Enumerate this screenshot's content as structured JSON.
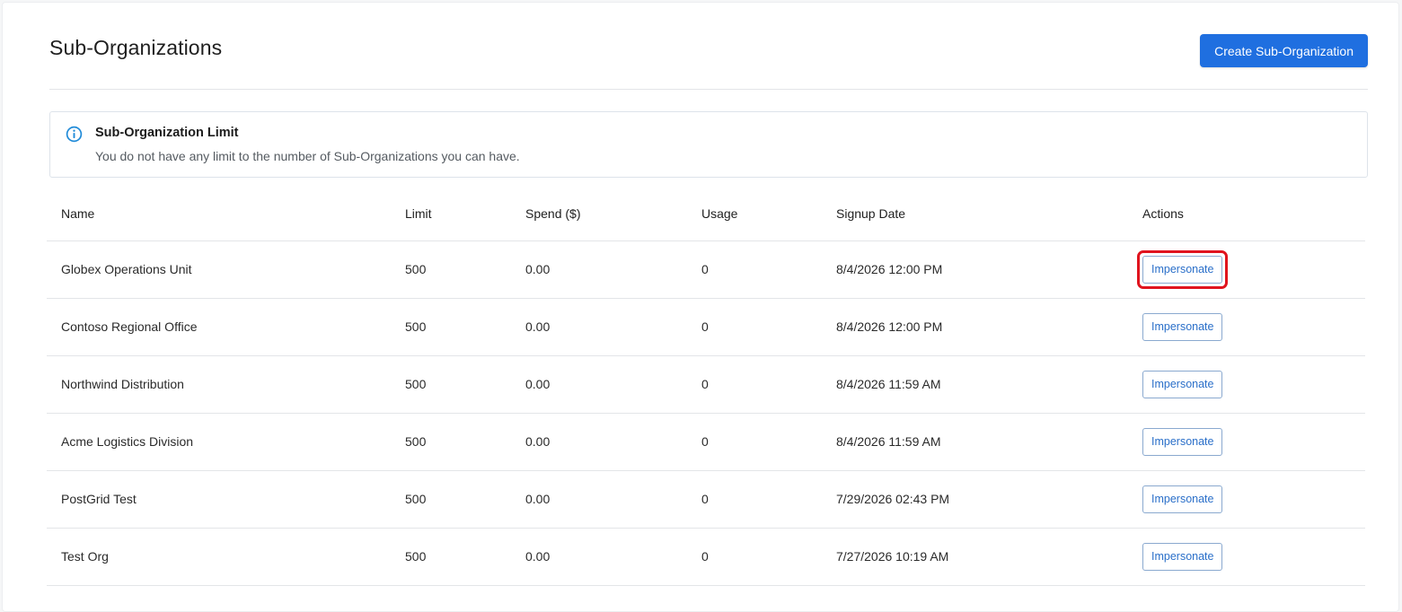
{
  "header": {
    "title": "Sub-Organizations",
    "create_button": "Create Sub-Organization"
  },
  "alert": {
    "icon": "info-icon",
    "title": "Sub-Organization Limit",
    "message": "You do not have any limit to the number of Sub-Organizations you can have."
  },
  "table": {
    "columns": [
      "Name",
      "Limit",
      "Spend ($)",
      "Usage",
      "Signup Date",
      "Actions"
    ],
    "rows": [
      {
        "name": "Globex Operations Unit",
        "limit": "500",
        "spend": "0.00",
        "usage": "0",
        "signup": "8/4/2026 12:00 PM",
        "action": "Impersonate"
      },
      {
        "name": "Contoso Regional Office",
        "limit": "500",
        "spend": "0.00",
        "usage": "0",
        "signup": "8/4/2026 12:00 PM",
        "action": "Impersonate"
      },
      {
        "name": "Northwind Distribution",
        "limit": "500",
        "spend": "0.00",
        "usage": "0",
        "signup": "8/4/2026 11:59 AM",
        "action": "Impersonate"
      },
      {
        "name": "Acme Logistics Division",
        "limit": "500",
        "spend": "0.00",
        "usage": "0",
        "signup": "8/4/2026 11:59 AM",
        "action": "Impersonate"
      },
      {
        "name": "PostGrid Test",
        "limit": "500",
        "spend": "0.00",
        "usage": "0",
        "signup": "7/29/2026 02:43 PM",
        "action": "Impersonate"
      },
      {
        "name": "Test Org",
        "limit": "500",
        "spend": "0.00",
        "usage": "0",
        "signup": "7/27/2026 10:19 AM",
        "action": "Impersonate"
      }
    ]
  },
  "colors": {
    "primary": "#1f6fe0",
    "link": "#2a6fc9",
    "highlight": "#e0141e",
    "info": "#1f8ad8"
  }
}
